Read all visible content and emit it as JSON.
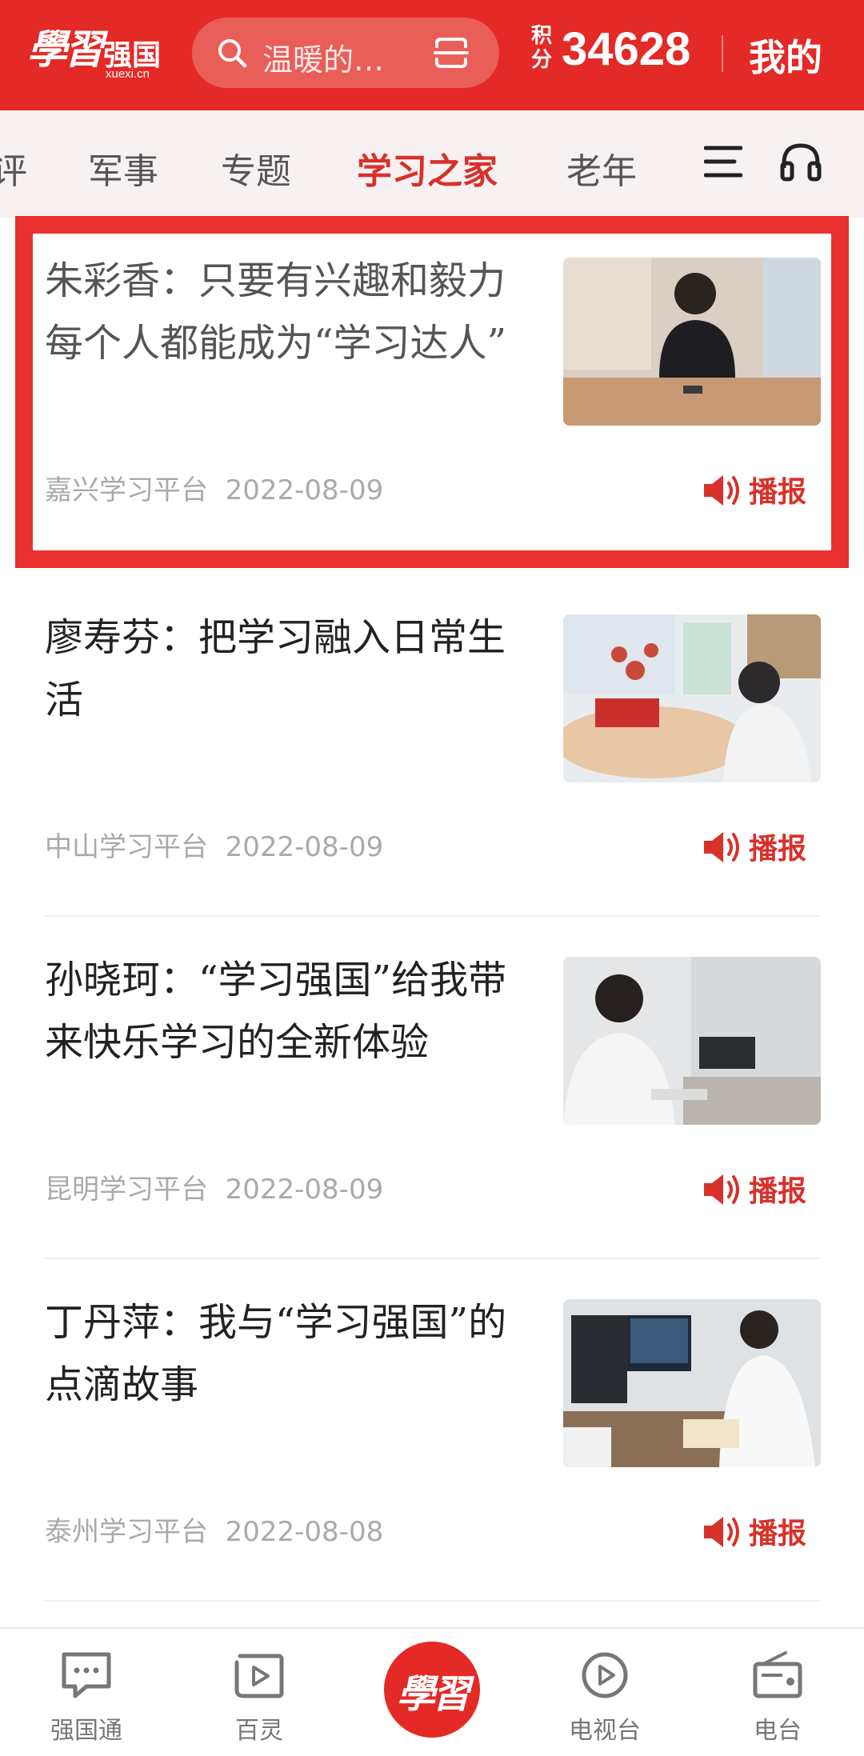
{
  "header": {
    "logo_script": "學習",
    "logo_name": "强国",
    "logo_domain": "xuexi.cn",
    "search_placeholder": "温暖的…",
    "points_label": "积分",
    "points_value": "34628",
    "mine_label": "我的"
  },
  "tabs": [
    {
      "label": "评"
    },
    {
      "label": "军事"
    },
    {
      "label": "专题"
    },
    {
      "label": "学习之家",
      "active": true
    },
    {
      "label": "老年"
    }
  ],
  "articles": [
    {
      "title": "朱彩香：只要有兴趣和毅力 每个人都能成为“学习达人”",
      "source": "嘉兴学习平台",
      "date": "2022-08-09",
      "broadcast_label": "播报",
      "highlighted": true
    },
    {
      "title": "廖寿芬：把学习融入日常生活",
      "source": "中山学习平台",
      "date": "2022-08-09",
      "broadcast_label": "播报"
    },
    {
      "title": "孙晓珂：“学习强国”给我带来快乐学习的全新体验",
      "source": "昆明学习平台",
      "date": "2022-08-09",
      "broadcast_label": "播报"
    },
    {
      "title": "丁丹萍：我与“学习强国”的点滴故事",
      "source": "泰州学习平台",
      "date": "2022-08-08",
      "broadcast_label": "播报"
    }
  ],
  "bottom_nav": {
    "items": [
      {
        "label": "强国通",
        "icon": "chat-icon"
      },
      {
        "label": "百灵",
        "icon": "play-square-icon"
      },
      {
        "label": "电视台",
        "icon": "play-circle-icon"
      },
      {
        "label": "电台",
        "icon": "radio-icon"
      }
    ],
    "center_logo": "學習"
  },
  "colors": {
    "brand_red": "#e32a27",
    "accent_red": "#d8312b",
    "highlight_frame": "#e8302e"
  }
}
